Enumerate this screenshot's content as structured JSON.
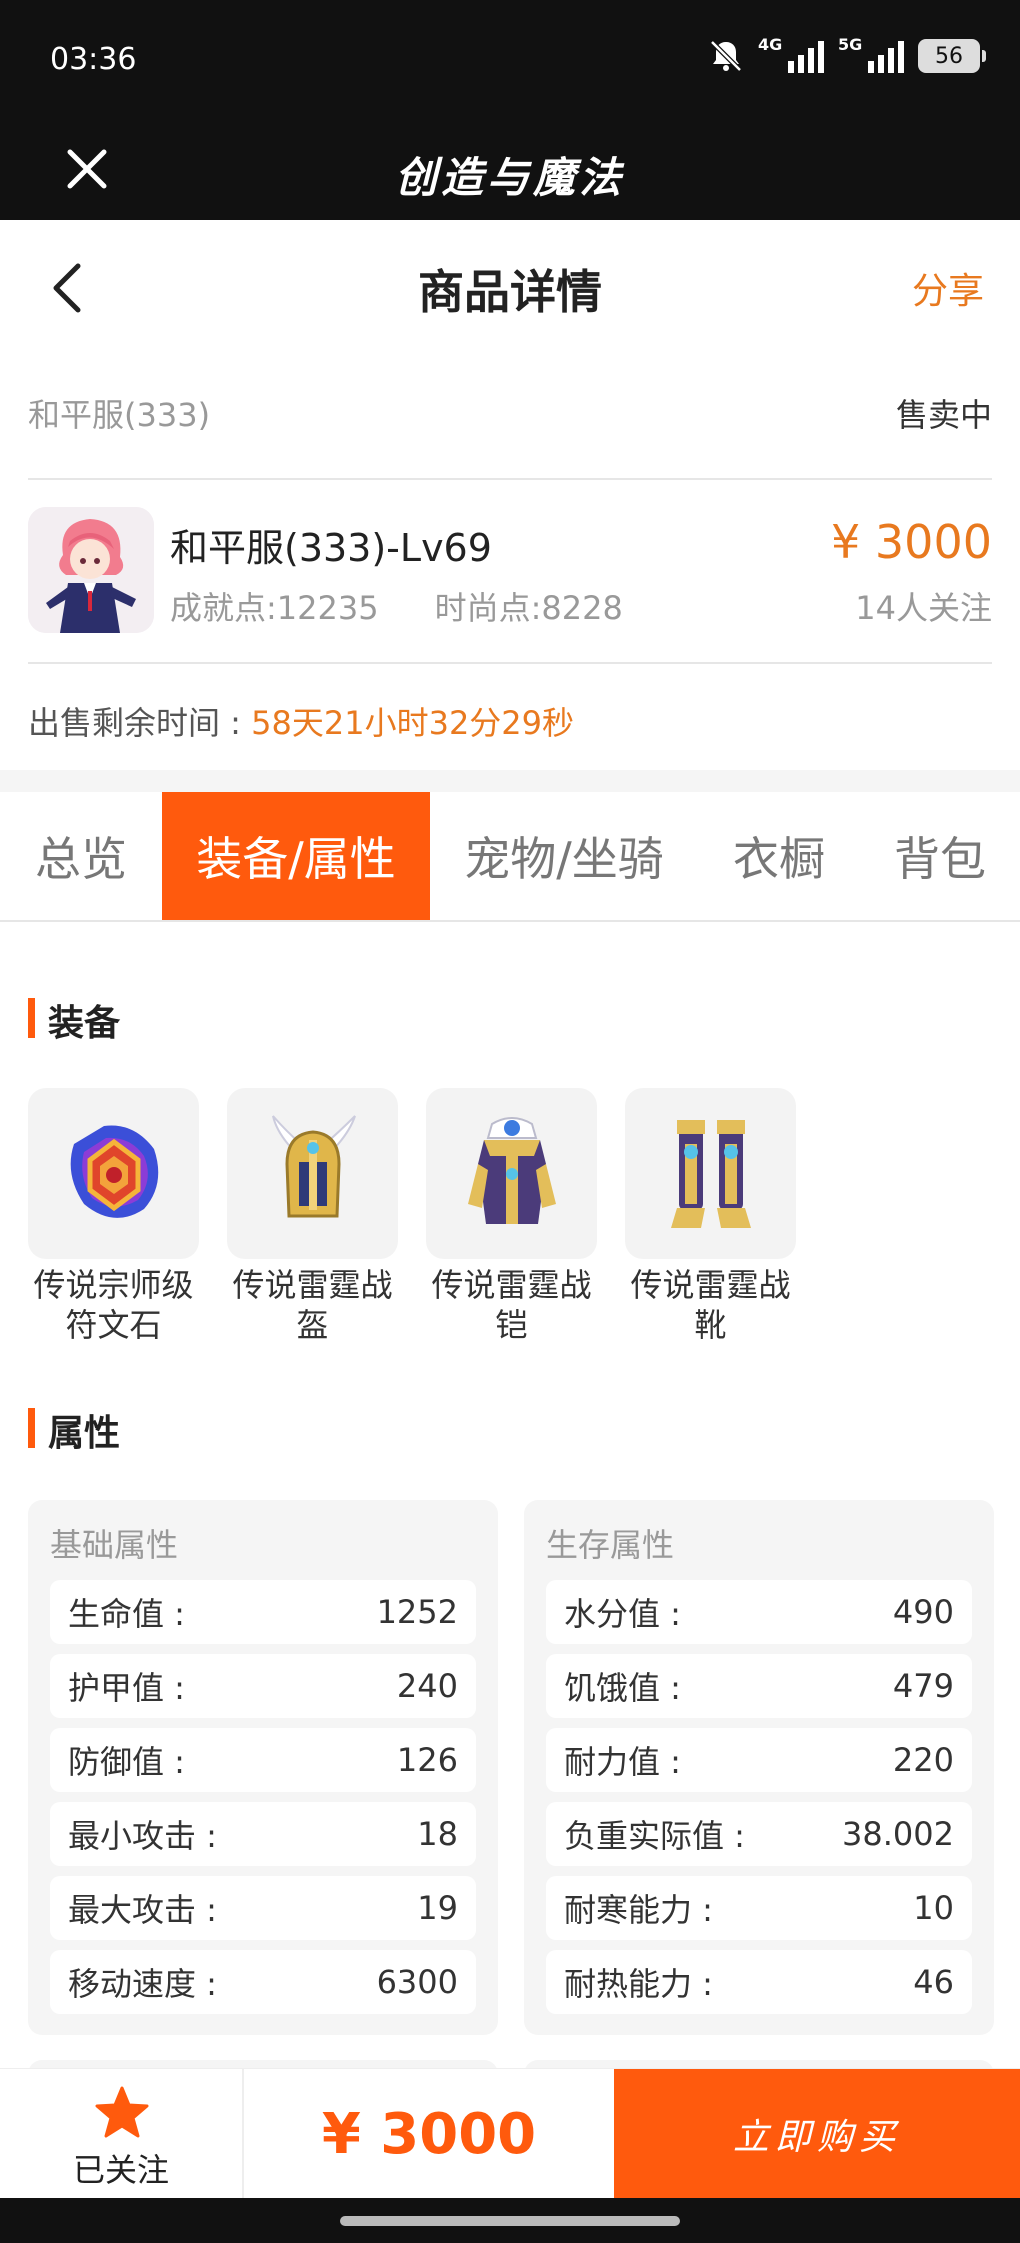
{
  "status_bar": {
    "time": "03:36",
    "net1": "4G",
    "net2": "5G",
    "battery": "56"
  },
  "app_bar": {
    "title": "创造与魔法",
    "close_icon": "close-icon"
  },
  "nav": {
    "title": "商品详情",
    "share_label": "分享",
    "back_icon": "chevron-left-icon"
  },
  "listing": {
    "server": "和平服(333)",
    "status": "售卖中",
    "character_name": "和平服(333)-Lv69",
    "achievement": "成就点:12235",
    "fashion": "时尚点:8228",
    "price": "¥ 3000",
    "followers": "14人关注",
    "sale_time_label": "出售剩余时间 :",
    "sale_time_value": "58天21小时32分29秒"
  },
  "tabs": [
    {
      "label": "总览",
      "active": false
    },
    {
      "label": "装备/属性",
      "active": true
    },
    {
      "label": "宠物/坐骑",
      "active": false
    },
    {
      "label": "衣橱",
      "active": false
    },
    {
      "label": "背包",
      "active": false
    }
  ],
  "equipment_section": {
    "title": "装备",
    "items": [
      {
        "label_line1": "传说宗师级",
        "label_line2": "符文石",
        "icon": "rune-stone-icon"
      },
      {
        "label_line1": "传说雷霆战",
        "label_line2": "盔",
        "icon": "winged-helmet-icon"
      },
      {
        "label_line1": "传说雷霆战",
        "label_line2": "铠",
        "icon": "armor-icon"
      },
      {
        "label_line1": "传说雷霆战",
        "label_line2": "靴",
        "icon": "boots-icon"
      }
    ]
  },
  "attributes_section": {
    "title": "属性",
    "basic": {
      "title": "基础属性",
      "rows": [
        {
          "name": "生命值 :",
          "value": "1252"
        },
        {
          "name": "护甲值 :",
          "value": "240"
        },
        {
          "name": "防御值 :",
          "value": "126"
        },
        {
          "name": "最小攻击 :",
          "value": "18"
        },
        {
          "name": "最大攻击 :",
          "value": "19"
        },
        {
          "name": "移动速度 :",
          "value": "6300"
        }
      ]
    },
    "survival": {
      "title": "生存属性",
      "rows": [
        {
          "name": "水分值 :",
          "value": "490"
        },
        {
          "name": "饥饿值 :",
          "value": "479"
        },
        {
          "name": "耐力值 :",
          "value": "220"
        },
        {
          "name": "负重实际值 :",
          "value": "38.002"
        },
        {
          "name": "耐寒能力 :",
          "value": "10"
        },
        {
          "name": "耐热能力 :",
          "value": "46"
        }
      ]
    }
  },
  "bottom_bar": {
    "follow_label": "已关注",
    "price": "¥ 3000",
    "buy_label": "立即购买"
  },
  "colors": {
    "accent": "#FF5A0D",
    "accent_text": "#E8791F",
    "dark_bar": "#111111"
  }
}
